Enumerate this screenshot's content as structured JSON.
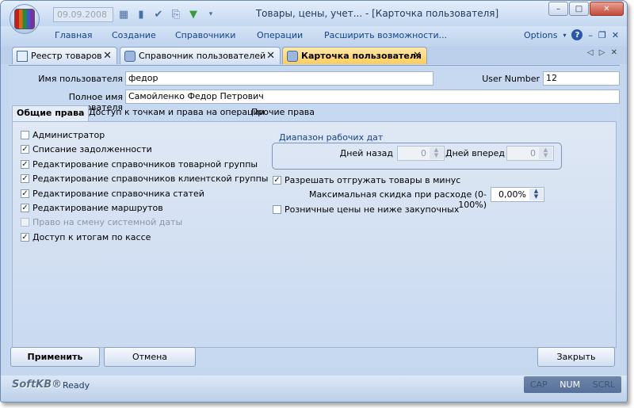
{
  "window": {
    "title": "Товары, цены, учет... - [Карточка пользователя]",
    "date": "09.09.2008",
    "buttons": {
      "minimize": "–",
      "maximize": "□",
      "close": "✕"
    }
  },
  "menu": {
    "items": [
      "Главная",
      "Создание",
      "Справочники",
      "Операции",
      "Расширить возможности..."
    ],
    "options": "Options"
  },
  "tabs": [
    {
      "label": "Реестр товаров",
      "active": false
    },
    {
      "label": "Справочник пользователей",
      "active": false
    },
    {
      "label": "Карточка пользователя",
      "active": true
    }
  ],
  "form": {
    "username_label": "Имя пользователя",
    "username_value": "федор",
    "fullname_label": "Полное имя пользователя",
    "fullname_value": "Самойленко Федор Петрович",
    "usernumber_label": "User Number",
    "usernumber_value": "12"
  },
  "subtabs": [
    "Общие права",
    "Доступ к точкам и права на операции",
    "Прочие права"
  ],
  "rights": [
    {
      "label": "Администратор",
      "checked": false,
      "disabled": false
    },
    {
      "label": "Списание задолженности",
      "checked": true,
      "disabled": false
    },
    {
      "label": "Редактирование справочников товарной группы",
      "checked": true,
      "disabled": false
    },
    {
      "label": "Редактирование справочников клиентской группы",
      "checked": true,
      "disabled": false
    },
    {
      "label": "Редактирование справочника статей",
      "checked": true,
      "disabled": false
    },
    {
      "label": "Редактирование маршрутов",
      "checked": true,
      "disabled": false
    },
    {
      "label": "Право на смену системной даты",
      "checked": false,
      "disabled": true
    },
    {
      "label": "Доступ к итогам по кассе",
      "checked": true,
      "disabled": false
    }
  ],
  "range": {
    "title": "Диапазон рабочих дат",
    "days_back_label": "Дней назад",
    "days_back_value": "0",
    "days_fwd_label": "Дней вперед",
    "days_fwd_value": "0"
  },
  "options": {
    "allow_negative_label": "Разрешать отгружать товары в минус",
    "allow_negative_checked": true,
    "max_discount_label": "Максимальная скидка при расходе (0-100%)",
    "max_discount_value": "0,00%",
    "retail_label": "Розничные цены не ниже закупочных",
    "retail_checked": false
  },
  "buttons": {
    "apply": "Применить",
    "cancel": "Отмена",
    "close": "Закрыть"
  },
  "status": {
    "brand": "SoftKB®",
    "text": "Ready",
    "keys": [
      "CAP",
      "NUM",
      "SCRL"
    ]
  }
}
